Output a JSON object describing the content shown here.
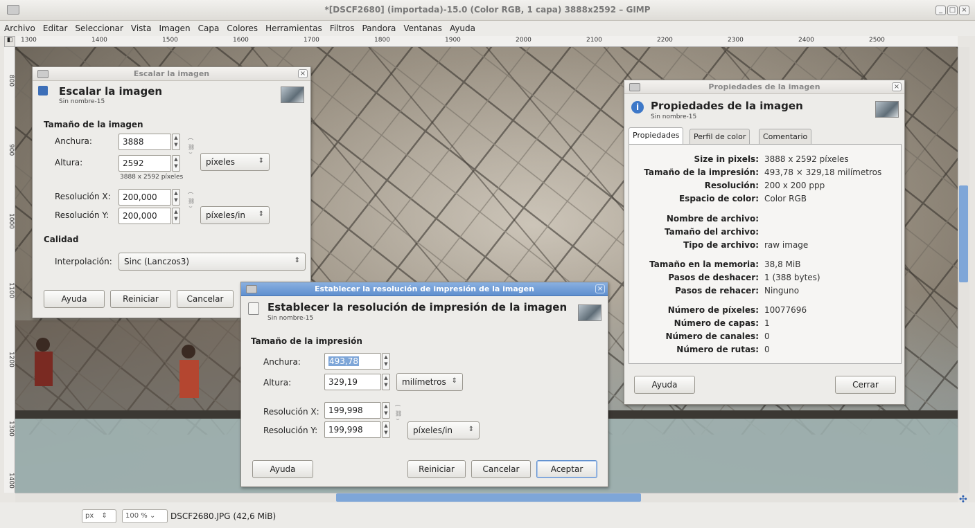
{
  "window": {
    "title": "*[DSCF2680] (importada)-15.0 (Color RGB, 1 capa) 3888x2592 – GIMP",
    "controls": [
      "_",
      "□",
      "×"
    ]
  },
  "menu": [
    "Archivo",
    "Editar",
    "Seleccionar",
    "Vista",
    "Imagen",
    "Capa",
    "Colores",
    "Herramientas",
    "Filtros",
    "Pandora",
    "Ventanas",
    "Ayuda"
  ],
  "ruler": {
    "h_ticks": [
      "1300",
      "1400",
      "1500",
      "1600",
      "1700",
      "1800",
      "1900",
      "2000",
      "2100",
      "2200",
      "2300",
      "2400",
      "2500"
    ],
    "v_ticks": [
      "800",
      "900",
      "1000",
      "1100",
      "1200",
      "1300",
      "1400"
    ]
  },
  "status": {
    "unit": "px",
    "zoom": "100 %",
    "file": "DSCF2680.JPG (42,6 MiB)"
  },
  "scale_dialog": {
    "window_title": "Escalar la imagen",
    "header_title": "Escalar la imagen",
    "subtitle": "Sin nombre-15",
    "section_size": "Tamaño de la imagen",
    "width_label": "Anchura:",
    "width_value": "3888",
    "height_label": "Altura:",
    "height_value": "2592",
    "size_note": "3888 x 2592 píxeles",
    "size_unit": "píxeles",
    "res_x_label": "Resolución X:",
    "res_x_value": "200,000",
    "res_y_label": "Resolución Y:",
    "res_y_value": "200,000",
    "res_unit": "píxeles/in",
    "section_quality": "Calidad",
    "interp_label": "Interpolación:",
    "interp_value": "Sinc (Lanczos3)",
    "btn_help": "Ayuda",
    "btn_reset": "Reiniciar",
    "btn_cancel": "Cancelar"
  },
  "print_dialog": {
    "window_title": "Establecer la resolución de impresión de la imagen",
    "header_title": "Establecer la resolución de impresión de la imagen",
    "subtitle": "Sin nombre-15",
    "section": "Tamaño de la impresión",
    "width_label": "Anchura:",
    "width_value": "493,78",
    "height_label": "Altura:",
    "height_value": "329,19",
    "size_unit": "milímetros",
    "res_x_label": "Resolución X:",
    "res_x_value": "199,998",
    "res_y_label": "Resolución Y:",
    "res_y_value": "199,998",
    "res_unit": "píxeles/in",
    "btn_help": "Ayuda",
    "btn_reset": "Reiniciar",
    "btn_cancel": "Cancelar",
    "btn_ok": "Aceptar"
  },
  "props_dialog": {
    "window_title": "Propiedades de la imagen",
    "header_title": "Propiedades de la imagen",
    "subtitle": "Sin nombre-15",
    "tabs": [
      "Propiedades",
      "Perfil de color",
      "Comentario"
    ],
    "rows": [
      {
        "k": "Size in pixels:",
        "v": "3888 x 2592 píxeles"
      },
      {
        "k": "Tamaño de la impresión:",
        "v": "493,78 × 329,18 milímetros"
      },
      {
        "k": "Resolución:",
        "v": "200 x 200 ppp"
      },
      {
        "k": "Espacio de color:",
        "v": "Color RGB"
      },
      {
        "k": "Nombre de archivo:",
        "v": ""
      },
      {
        "k": "Tamaño del archivo:",
        "v": ""
      },
      {
        "k": "Tipo de archivo:",
        "v": "raw image"
      },
      {
        "k": "Tamaño en la memoria:",
        "v": "38,8 MiB"
      },
      {
        "k": "Pasos de deshacer:",
        "v": "1 (388 bytes)"
      },
      {
        "k": "Pasos de rehacer:",
        "v": "Ninguno"
      },
      {
        "k": "Número de píxeles:",
        "v": "10077696"
      },
      {
        "k": "Número de capas:",
        "v": "1"
      },
      {
        "k": "Número de canales:",
        "v": "0"
      },
      {
        "k": "Número de rutas:",
        "v": "0"
      }
    ],
    "btn_help": "Ayuda",
    "btn_close": "Cerrar"
  },
  "colors": {
    "active_title": "#5e8fcf",
    "scroll_thumb": "#7ea6d8",
    "selection": "#7ea6d8"
  }
}
